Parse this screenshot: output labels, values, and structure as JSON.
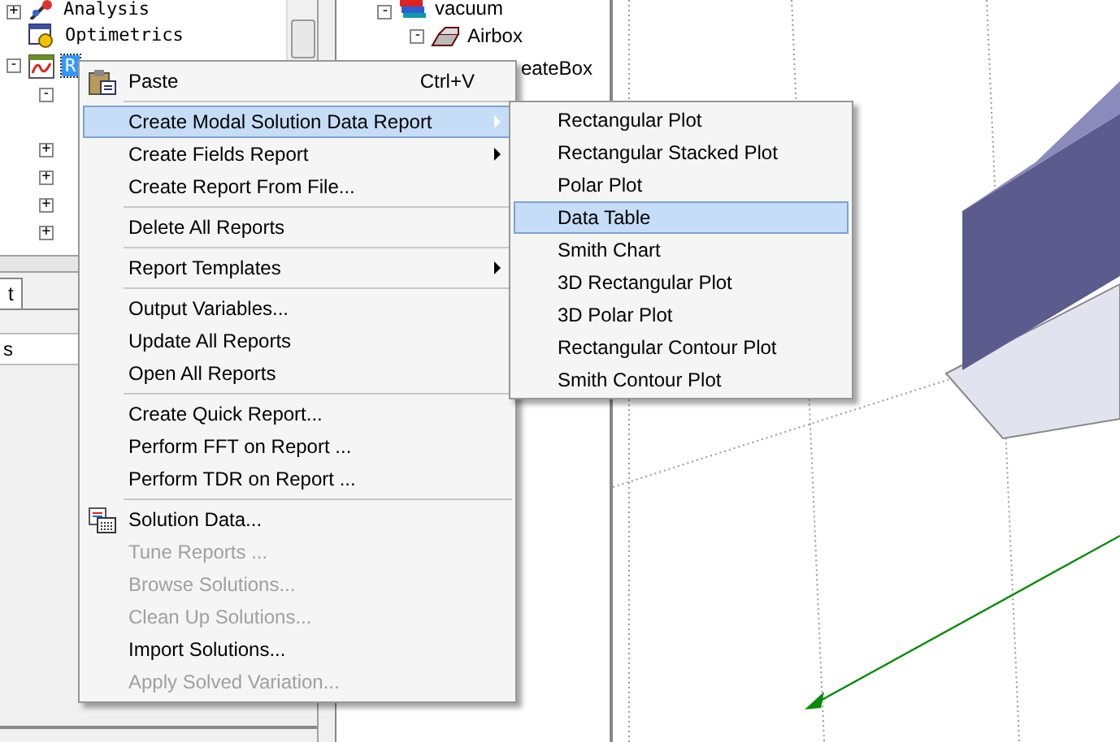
{
  "project_tree": {
    "items": [
      {
        "label": "Analysis",
        "expander": "+",
        "selected": false
      },
      {
        "label": "Optimetrics",
        "selected": false
      },
      {
        "label": "R",
        "expander": "-",
        "selected": true
      }
    ],
    "children": [
      {
        "kind": "toggle",
        "expander": "-"
      },
      {
        "kind": "blank"
      },
      {
        "kind": "toggle",
        "expander": "+"
      },
      {
        "kind": "toggle",
        "expander": "+"
      },
      {
        "kind": "toggle",
        "expander": "+"
      },
      {
        "kind": "toggle",
        "expander": "+"
      }
    ]
  },
  "lower_tab": {
    "label": "t"
  },
  "lower_header": {
    "label": "s"
  },
  "model_tree": {
    "items": [
      {
        "label": "vacuum",
        "expander": "-"
      },
      {
        "label": "Airbox",
        "expander": "-"
      },
      {
        "label": "eateBox"
      }
    ]
  },
  "context_menu": {
    "items": [
      {
        "kind": "item",
        "label": "Paste",
        "shortcut": "Ctrl+V",
        "disabled": false,
        "selected": false,
        "submenu": false
      },
      {
        "kind": "separator"
      },
      {
        "kind": "item",
        "label": "Create Modal Solution Data Report",
        "disabled": false,
        "selected": true,
        "submenu": true
      },
      {
        "kind": "item",
        "label": "Create Fields Report",
        "disabled": false,
        "selected": false,
        "submenu": true
      },
      {
        "kind": "item",
        "label": "Create Report From File...",
        "disabled": false,
        "selected": false,
        "submenu": false
      },
      {
        "kind": "separator"
      },
      {
        "kind": "item",
        "label": "Delete All Reports",
        "disabled": false,
        "selected": false,
        "submenu": false
      },
      {
        "kind": "separator"
      },
      {
        "kind": "item",
        "label": "Report Templates",
        "disabled": false,
        "selected": false,
        "submenu": true
      },
      {
        "kind": "separator"
      },
      {
        "kind": "item",
        "label": "Output Variables...",
        "disabled": false,
        "selected": false,
        "submenu": false
      },
      {
        "kind": "item",
        "label": "Update All Reports",
        "disabled": false,
        "selected": false,
        "submenu": false
      },
      {
        "kind": "item",
        "label": "Open All Reports",
        "disabled": false,
        "selected": false,
        "submenu": false
      },
      {
        "kind": "separator"
      },
      {
        "kind": "item",
        "label": "Create Quick Report...",
        "disabled": false,
        "selected": false,
        "submenu": false
      },
      {
        "kind": "item",
        "label": "Perform FFT on Report ...",
        "disabled": false,
        "selected": false,
        "submenu": false
      },
      {
        "kind": "item",
        "label": "Perform TDR on Report ...",
        "disabled": false,
        "selected": false,
        "submenu": false
      },
      {
        "kind": "separator"
      },
      {
        "kind": "item",
        "label": "Solution Data...",
        "disabled": false,
        "selected": false,
        "submenu": false
      },
      {
        "kind": "item",
        "label": "Tune Reports ...",
        "disabled": true,
        "selected": false,
        "submenu": false
      },
      {
        "kind": "item",
        "label": "Browse Solutions...",
        "disabled": true,
        "selected": false,
        "submenu": false
      },
      {
        "kind": "item",
        "label": "Clean Up Solutions...",
        "disabled": true,
        "selected": false,
        "submenu": false
      },
      {
        "kind": "item",
        "label": "Import Solutions...",
        "disabled": false,
        "selected": false,
        "submenu": false
      },
      {
        "kind": "item",
        "label": "Apply Solved Variation...",
        "disabled": true,
        "selected": false,
        "submenu": false
      }
    ]
  },
  "submenu": {
    "items": [
      {
        "label": "Rectangular Plot",
        "selected": false
      },
      {
        "label": "Rectangular Stacked Plot",
        "selected": false
      },
      {
        "label": "Polar Plot",
        "selected": false
      },
      {
        "label": "Data Table",
        "selected": true
      },
      {
        "label": "Smith Chart",
        "selected": false
      },
      {
        "label": "3D Rectangular Plot",
        "selected": false
      },
      {
        "label": "3D Polar Plot",
        "selected": false
      },
      {
        "label": "Rectangular Contour Plot",
        "selected": false
      },
      {
        "label": "Smith Contour Plot",
        "selected": false
      }
    ]
  }
}
